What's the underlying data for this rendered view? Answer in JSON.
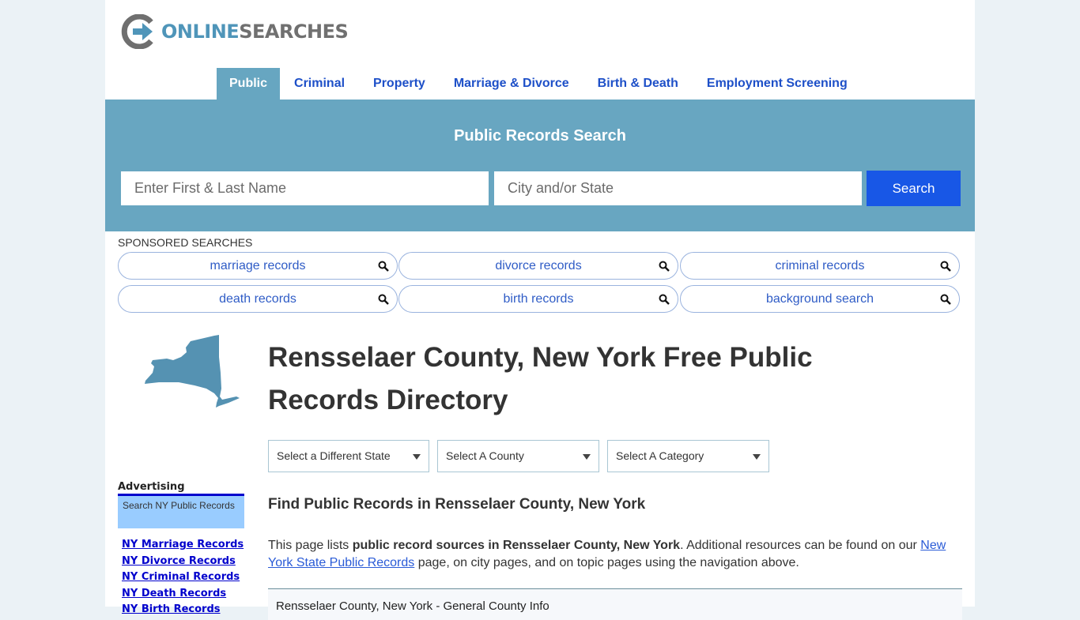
{
  "logo": {
    "part1": "ONLINE",
    "part2": "SEARCHES"
  },
  "nav": {
    "items": [
      {
        "label": "Public",
        "active": true
      },
      {
        "label": "Criminal"
      },
      {
        "label": "Property"
      },
      {
        "label": "Marriage & Divorce"
      },
      {
        "label": "Birth & Death"
      },
      {
        "label": "Employment Screening"
      }
    ]
  },
  "search": {
    "title": "Public Records Search",
    "name_placeholder": "Enter First & Last Name",
    "city_placeholder": "City and/or State",
    "button_label": "Search"
  },
  "sponsored": {
    "label": "SPONSORED SEARCHES",
    "items": [
      "marriage records",
      "divorce records",
      "criminal records",
      "death records",
      "birth records",
      "background search"
    ]
  },
  "page": {
    "title": "Rensselaer County, New York Free Public Records Directory",
    "selects": {
      "state": "Select a Different State",
      "county": "Select A County",
      "category": "Select A Category"
    },
    "section_title": "Find Public Records in Rensselaer County, New York",
    "intro": {
      "prefix": "This page lists ",
      "bold": "public record sources in Rensselaer County, New York",
      "middle": ". Additional resources can be found on our ",
      "link": "New York State Public Records",
      "suffix": " page, on city pages, and on topic pages using the navigation above."
    },
    "info_title": "Rensselaer County, New York - General County Info"
  },
  "sidebar": {
    "advertising_label": "Advertising",
    "ad_box": "Search NY Public Records",
    "links": [
      "NY Marriage Records",
      "NY Divorce Records",
      "NY Criminal Records",
      "NY Death Records",
      "NY Birth Records"
    ]
  },
  "colors": {
    "brand_blue": "#68a6c1",
    "nav_link": "#1e50c8",
    "search_button": "#1857e6",
    "ad_box": "#99ccff"
  }
}
